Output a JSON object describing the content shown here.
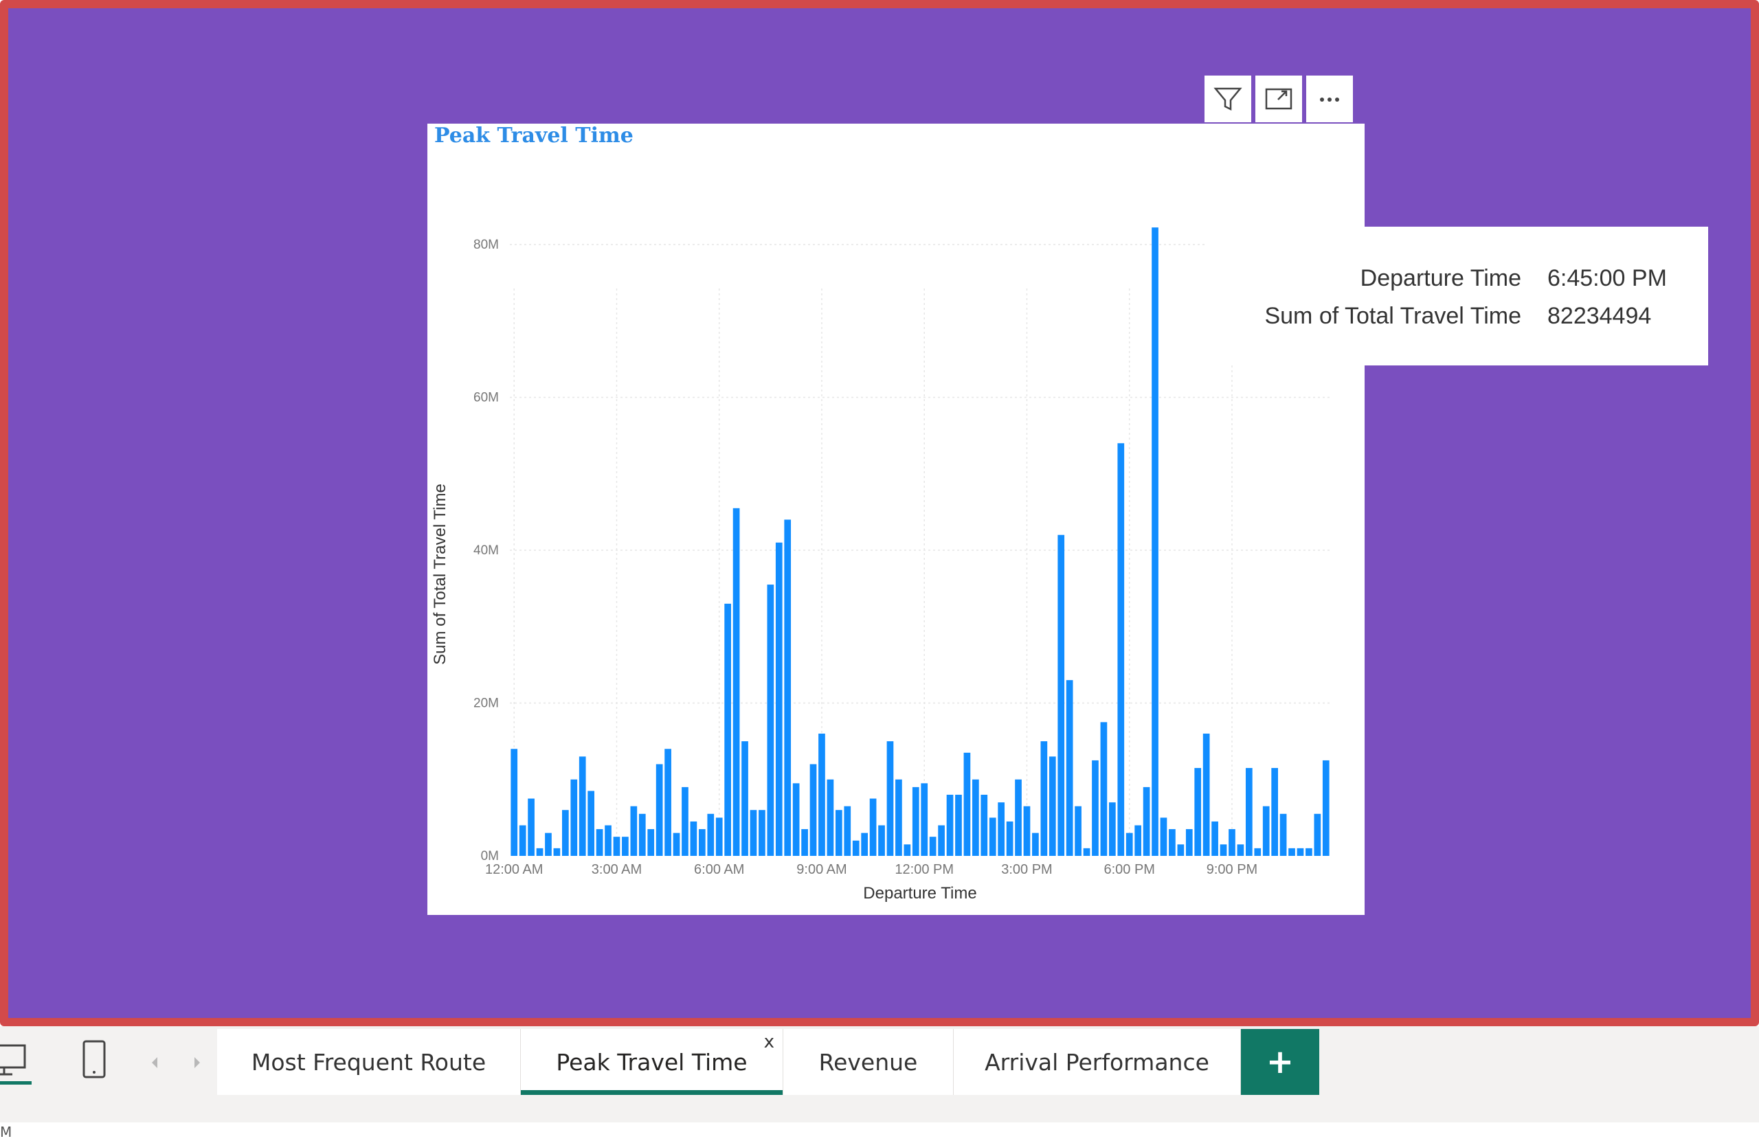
{
  "visual": {
    "title": "Peak Travel Time",
    "toolbar": [
      "filter-icon",
      "focus-mode-icon",
      "more-options-icon"
    ]
  },
  "tooltip": {
    "rows": [
      {
        "label": "Departure Time",
        "value": "6:45:00 PM"
      },
      {
        "label": "Sum of Total Travel Time",
        "value": "82234494"
      }
    ]
  },
  "tabs": {
    "items": [
      {
        "label": "Most Frequent Route"
      },
      {
        "label": "Peak Travel Time",
        "active": true,
        "close": "x"
      },
      {
        "label": "Revenue"
      },
      {
        "label": "Arrival Performance"
      }
    ],
    "add_label": "+"
  },
  "status": {
    "text": "M"
  },
  "colors": {
    "accent": "#118dff",
    "canvas": "#7a4fbf",
    "border": "#d24a4a",
    "tab_accent": "#117865"
  },
  "chart_data": {
    "type": "bar",
    "title": "Peak Travel Time",
    "xlabel": "Departure Time",
    "ylabel": "Sum of Total Travel Time",
    "ylim": [
      0,
      85000000
    ],
    "y_ticks": [
      "0M",
      "20M",
      "40M",
      "60M",
      "80M"
    ],
    "x_ticks": [
      "12:00 AM",
      "3:00 AM",
      "6:00 AM",
      "9:00 AM",
      "12:00 PM",
      "3:00 PM",
      "6:00 PM",
      "9:00 PM"
    ],
    "x_unit": "15-minute intervals from 12:00 AM",
    "values": [
      14000000,
      4000000,
      7500000,
      1000000,
      3000000,
      1000000,
      6000000,
      10000000,
      13000000,
      8500000,
      3500000,
      4000000,
      2500000,
      2500000,
      6500000,
      5500000,
      3500000,
      12000000,
      14000000,
      3000000,
      9000000,
      4500000,
      3500000,
      5500000,
      5000000,
      33000000,
      45500000,
      15000000,
      6000000,
      6000000,
      35500000,
      41000000,
      44000000,
      9500000,
      3500000,
      12000000,
      16000000,
      10000000,
      6000000,
      6500000,
      2000000,
      3000000,
      7500000,
      4000000,
      15000000,
      10000000,
      1500000,
      9000000,
      9500000,
      2500000,
      4000000,
      8000000,
      8000000,
      13500000,
      10000000,
      8000000,
      5000000,
      7000000,
      4500000,
      10000000,
      6500000,
      3000000,
      15000000,
      13000000,
      42000000,
      23000000,
      6500000,
      1000000,
      12500000,
      17500000,
      7000000,
      54000000,
      3000000,
      4000000,
      9000000,
      82234494,
      5000000,
      3500000,
      1500000,
      3500000,
      11500000,
      16000000,
      4500000,
      1500000,
      3500000,
      1500000,
      11500000,
      1000000,
      6500000,
      11500000,
      5500000,
      1000000,
      1000000,
      1000000,
      5500000,
      12500000
    ]
  }
}
